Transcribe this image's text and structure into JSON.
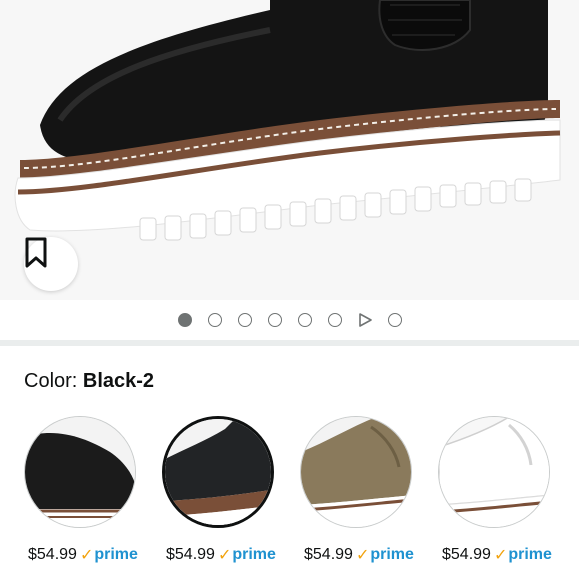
{
  "carousel": {
    "slides": [
      "dot",
      "dot",
      "dot",
      "dot",
      "dot",
      "dot",
      "video",
      "dot"
    ],
    "active_index": 0
  },
  "icons": {
    "bookmark": "bookmark-icon",
    "play": "play-icon",
    "prime_check": "checkmark-icon"
  },
  "color_selector": {
    "label": "Color: ",
    "value": "Black-2"
  },
  "swatches": [
    {
      "color": "#1b1b1b",
      "price": "$54.99",
      "prime": "prime",
      "style": "suede-black"
    },
    {
      "color": "#222426",
      "price": "$54.99",
      "prime": "prime",
      "style": "leather-black",
      "selected": true
    },
    {
      "color": "#8a7a5c",
      "price": "$54.99",
      "prime": "prime",
      "style": "suede-khaki"
    },
    {
      "color": "#f4f4f4",
      "price": "$54.99",
      "prime": "prime",
      "style": "leather-white"
    }
  ],
  "colors": {
    "prime_blue": "#1f92d0",
    "prime_check": "#f2a30e",
    "text": "#0f1111",
    "divider": "#eaeded"
  }
}
